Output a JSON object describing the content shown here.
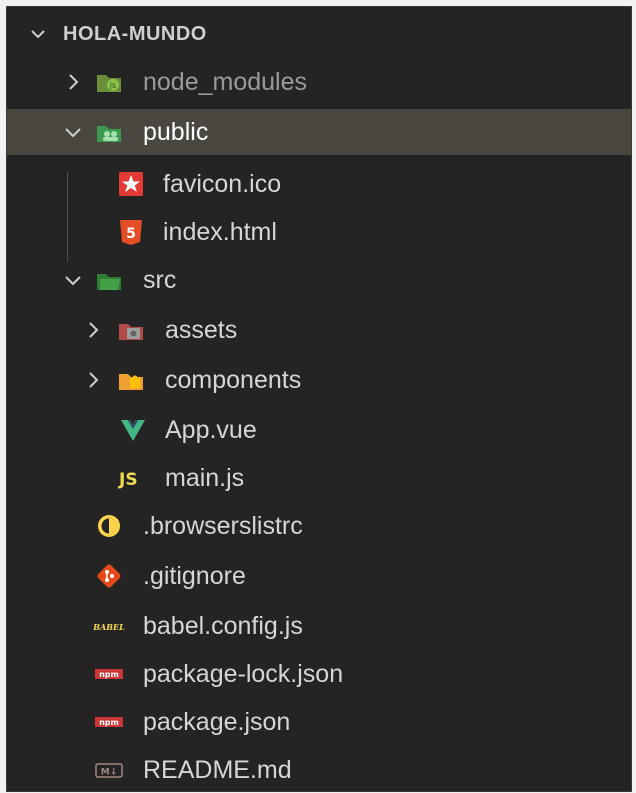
{
  "explorer": {
    "title": "HOLA-MUNDO",
    "items": [
      {
        "label": "node_modules",
        "icon": "node-modules-folder-icon",
        "kind": "folder",
        "expanded": false
      },
      {
        "label": "public",
        "icon": "public-folder-icon",
        "kind": "folder",
        "expanded": true,
        "selected": true
      },
      {
        "label": "favicon.ico",
        "icon": "favicon-icon",
        "kind": "file"
      },
      {
        "label": "index.html",
        "icon": "html5-icon",
        "kind": "file"
      },
      {
        "label": "src",
        "icon": "src-folder-icon",
        "kind": "folder",
        "expanded": true
      },
      {
        "label": "assets",
        "icon": "assets-folder-icon",
        "kind": "folder",
        "expanded": false
      },
      {
        "label": "components",
        "icon": "components-folder-icon",
        "kind": "folder",
        "expanded": false
      },
      {
        "label": "App.vue",
        "icon": "vue-icon",
        "kind": "file"
      },
      {
        "label": "main.js",
        "icon": "js-icon",
        "kind": "file",
        "icon_text": "JS"
      },
      {
        "label": ".browserslistrc",
        "icon": "browserslist-icon",
        "kind": "file"
      },
      {
        "label": ".gitignore",
        "icon": "git-icon",
        "kind": "file"
      },
      {
        "label": "babel.config.js",
        "icon": "babel-icon",
        "kind": "file",
        "icon_text": "BABEL"
      },
      {
        "label": "package-lock.json",
        "icon": "npm-icon",
        "kind": "file",
        "icon_text": "npm"
      },
      {
        "label": "package.json",
        "icon": "npm-icon",
        "kind": "file",
        "icon_text": "npm"
      },
      {
        "label": "README.md",
        "icon": "markdown-icon",
        "kind": "file",
        "icon_text": "M↓"
      }
    ]
  },
  "colors": {
    "background": "#242424",
    "selected_row": "#4a4740",
    "text": "#d6d6d6",
    "dim_text": "#9a9a9a",
    "folder_green": "#4caf50",
    "html_orange": "#e44d26",
    "vue_green": "#41b883",
    "js_yellow": "#f0db4f",
    "git_red": "#e64a19",
    "npm_red": "#cb3837"
  }
}
